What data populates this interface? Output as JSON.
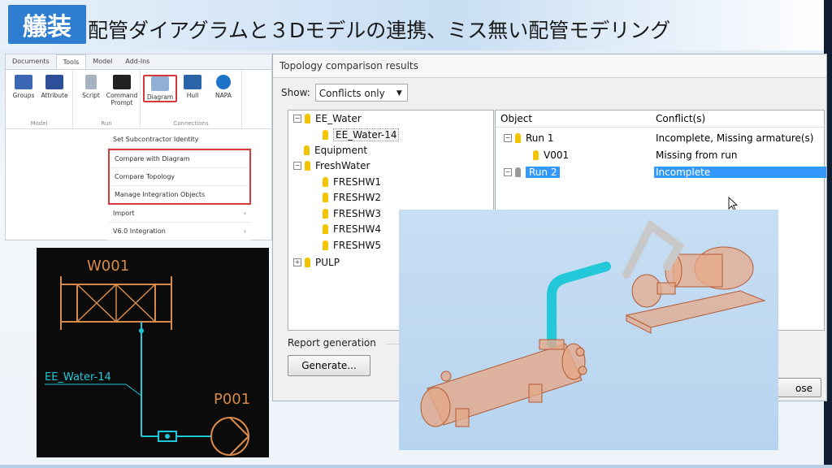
{
  "slide": {
    "tag": "艤装",
    "title": "配管ダイアグラムと３Dモデルの連携、ミス無い配管モデリング"
  },
  "ribbon": {
    "tabs": [
      "Documents",
      "Tools",
      "Model",
      "Add-Ins"
    ],
    "active_tab": "Tools",
    "groups": [
      {
        "label": "Model",
        "buttons": [
          "Groups",
          "Attribute"
        ]
      },
      {
        "label": "Run",
        "buttons": [
          "Script",
          "Command Prompt"
        ]
      },
      {
        "label": "Connections",
        "buttons": [
          "Diagram",
          "Hull",
          "NAPA"
        ]
      }
    ],
    "menu": [
      {
        "label": "Set Subcontractor Identity"
      },
      {
        "label": "Compare with Diagram"
      },
      {
        "label": "Compare Topology"
      },
      {
        "label": "Manage Integration Objects"
      },
      {
        "label": "Import"
      },
      {
        "label": "V6.0 Integration"
      }
    ],
    "submenu_arrow": "›"
  },
  "topology": {
    "title": "Topology comparison results",
    "show_label": "Show:",
    "show_value": "Conflicts only",
    "tree": [
      {
        "label": "EE_Water",
        "level": 0,
        "expander": "−"
      },
      {
        "label": "EE_Water-14",
        "level": 1,
        "expander": ""
      },
      {
        "label": "Equipment",
        "level": 0,
        "expander": ""
      },
      {
        "label": "FreshWater",
        "level": 0,
        "expander": "−"
      },
      {
        "label": "FRESHW1",
        "level": 1,
        "expander": ""
      },
      {
        "label": "FRESHW2",
        "level": 1,
        "expander": ""
      },
      {
        "label": "FRESHW3",
        "level": 1,
        "expander": ""
      },
      {
        "label": "FRESHW4",
        "level": 1,
        "expander": ""
      },
      {
        "label": "FRESHW5",
        "level": 1,
        "expander": ""
      },
      {
        "label": "PULP",
        "level": 0,
        "expander": "+"
      }
    ],
    "columns": [
      "Object",
      "Conflict(s)"
    ],
    "rows": [
      {
        "object": "Run 1",
        "conflict": "Incomplete, Missing armature(s)",
        "expander": "−"
      },
      {
        "object": "V001",
        "conflict": "Missing from run",
        "expander": ""
      },
      {
        "object": "Run 2",
        "conflict": "Incomplete",
        "expander": "−"
      }
    ],
    "report_label": "Report generation",
    "generate_label": "Generate...",
    "close_label": "ose"
  },
  "diagram": {
    "equipment_w": "W001",
    "line_label": "EE_Water-14",
    "equipment_p": "P001",
    "line_color": "#1ec8d8",
    "symbol_color": "#d88a4a"
  },
  "colors": {
    "accent": "#2f7dd0",
    "selection": "#3399ff",
    "highlight": "#d63a3a",
    "model_pipe_cyan": "#22c8d8",
    "model_equipment": "#d98a5a"
  }
}
